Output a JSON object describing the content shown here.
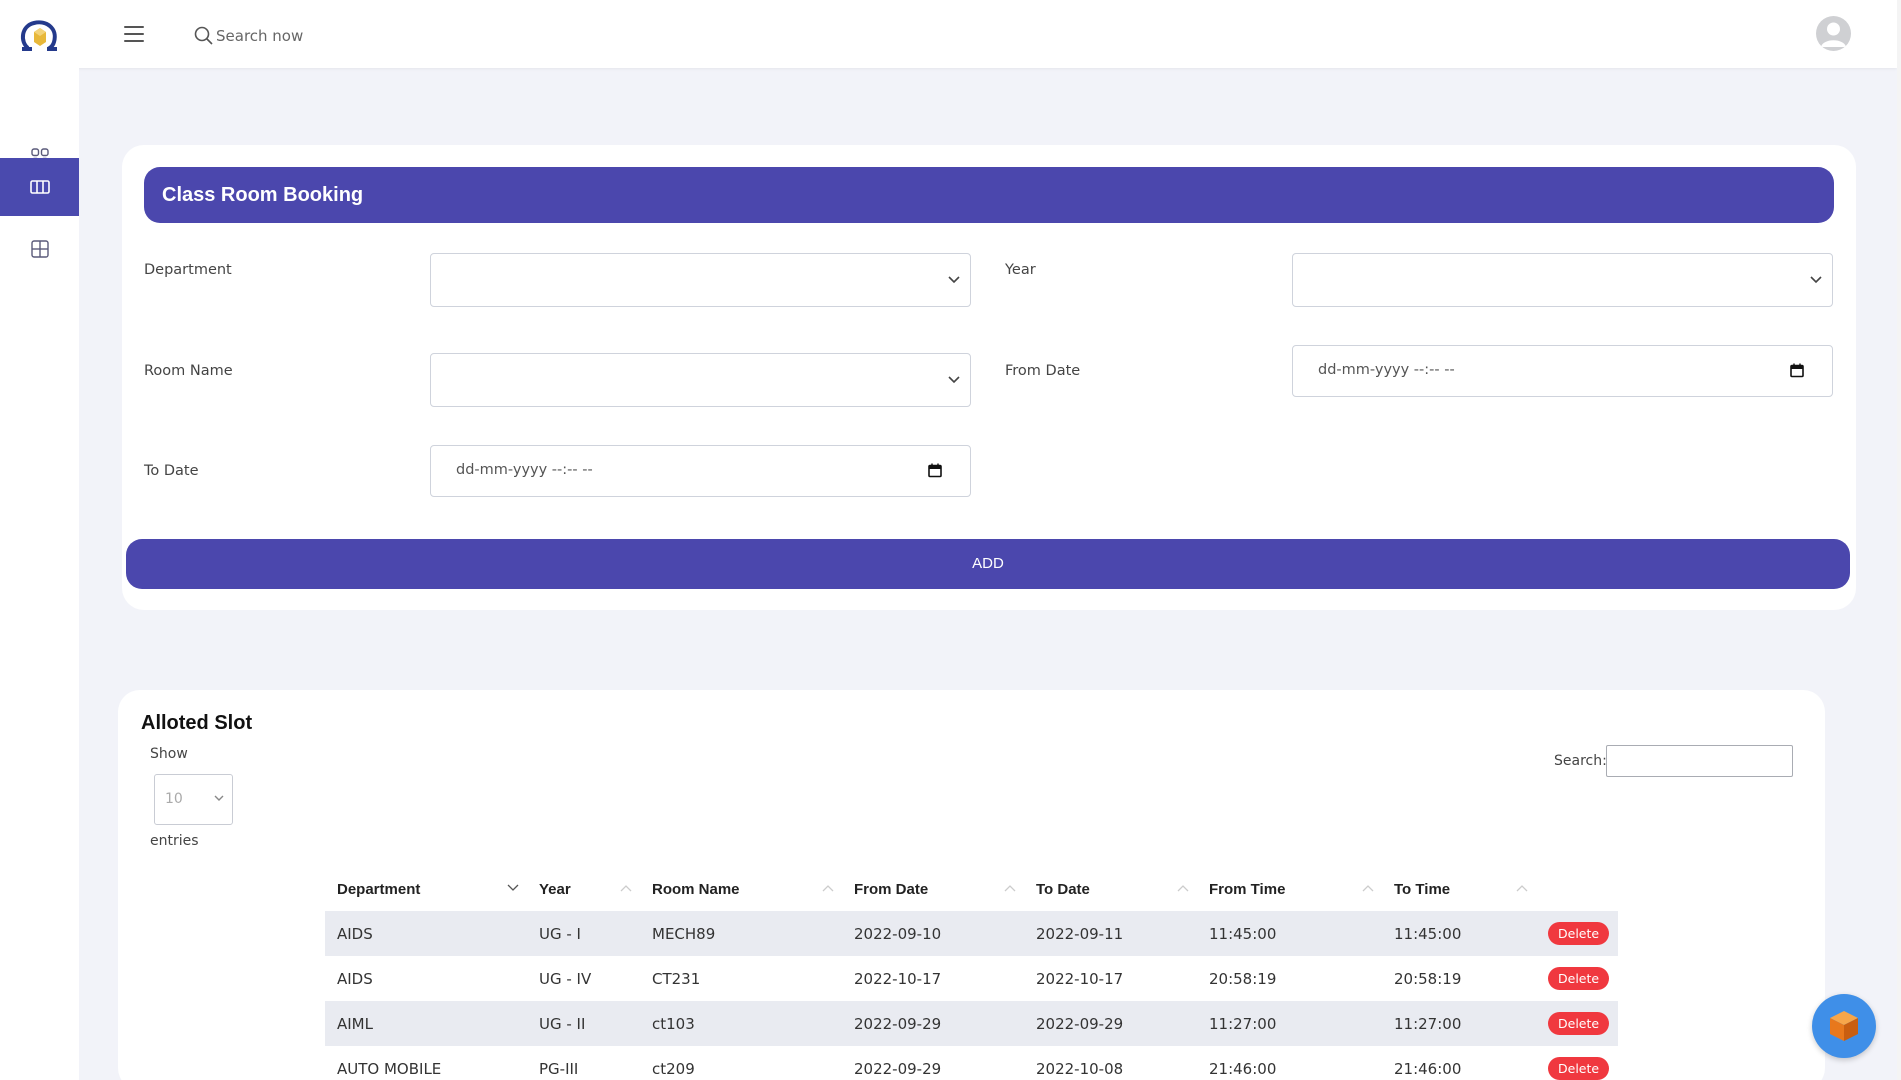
{
  "header": {
    "search_placeholder": "Search now",
    "logo_icon": "institution-logo",
    "menu_icon": "hamburger-icon",
    "avatar_icon": "user-avatar"
  },
  "sidebar": {
    "items": [
      {
        "icon": "dashboard-grid-icon",
        "active": false
      },
      {
        "icon": "columns-icon",
        "active": true
      },
      {
        "icon": "table-grid-icon",
        "active": false
      }
    ]
  },
  "booking": {
    "title": "Class Room Booking",
    "fields": {
      "department_label": "Department",
      "year_label": "Year",
      "room_name_label": "Room Name",
      "from_date_label": "From Date",
      "to_date_label": "To Date",
      "date_placeholder": "dd-mm-yyyy --:-- --"
    },
    "add_label": "ADD"
  },
  "slots": {
    "title": "Alloted Slot",
    "show_label": "Show",
    "entries_value": "10",
    "entries_label": "entries",
    "search_label": "Search:",
    "columns": [
      "Department",
      "Year",
      "Room Name",
      "From Date",
      "To Date",
      "From Time",
      "To Time"
    ],
    "rows": [
      {
        "department": "AIDS",
        "year": "UG - I",
        "room": "MECH89",
        "from_date": "2022-09-10",
        "to_date": "2022-09-11",
        "from_time": "11:45:00",
        "to_time": "11:45:00",
        "action": "Delete"
      },
      {
        "department": "AIDS",
        "year": "UG - IV",
        "room": "CT231",
        "from_date": "2022-10-17",
        "to_date": "2022-10-17",
        "from_time": "20:58:19",
        "to_time": "20:58:19",
        "action": "Delete"
      },
      {
        "department": "AIML",
        "year": "UG - II",
        "room": "ct103",
        "from_date": "2022-09-29",
        "to_date": "2022-09-29",
        "from_time": "11:27:00",
        "to_time": "11:27:00",
        "action": "Delete"
      },
      {
        "department": "AUTO MOBILE",
        "year": "PG-III",
        "room": "ct209",
        "from_date": "2022-09-29",
        "to_date": "2022-10-08",
        "from_time": "21:46:00",
        "to_time": "21:46:00",
        "action": "Delete"
      }
    ]
  },
  "colors": {
    "accent": "#4b47ad",
    "delete": "#f0383f",
    "background": "#f2f3f9"
  }
}
